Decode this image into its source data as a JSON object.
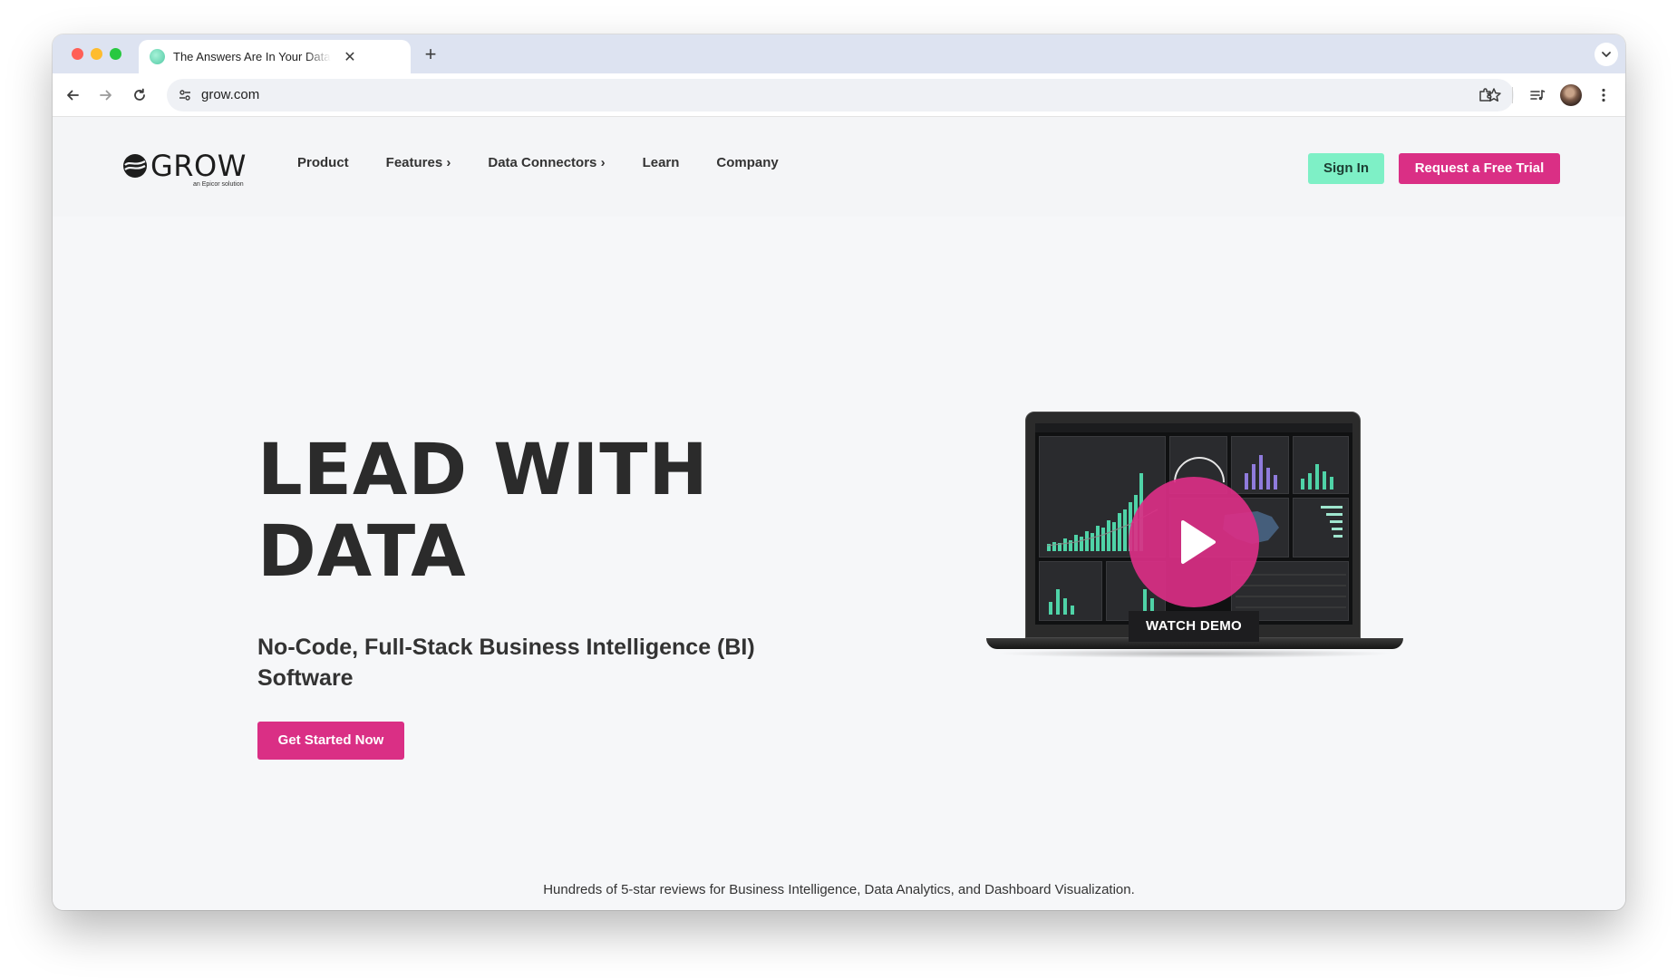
{
  "browser": {
    "tab_title": "The Answers Are In Your Data",
    "url": "grow.com"
  },
  "header": {
    "logo_text": "GROW",
    "logo_subtext": "an Epicor solution",
    "nav": [
      {
        "label": "Product"
      },
      {
        "label": "Features ›"
      },
      {
        "label": "Data Connectors ›"
      },
      {
        "label": "Learn"
      },
      {
        "label": "Company"
      }
    ],
    "signin_label": "Sign In",
    "trial_label": "Request a Free Trial"
  },
  "hero": {
    "title": "LEAD WITH DATA",
    "subtitle": "No-Code, Full-Stack Business Intelligence (BI) Software",
    "cta_label": "Get Started Now",
    "watch_demo_label": "WATCH DEMO"
  },
  "reviews_text": "Hundreds of 5-star reviews for Business Intelligence, Data Analytics, and Dashboard Visualization.",
  "colors": {
    "accent_pink": "#da2f85",
    "accent_mint": "#7ef0c6",
    "text_dark": "#2b2b2b"
  },
  "icons": [
    "close-icon",
    "plus-icon",
    "chevron-down-icon",
    "back-arrow-icon",
    "forward-arrow-icon",
    "reload-icon",
    "site-info-icon",
    "star-icon",
    "extensions-icon",
    "media-control-icon",
    "kebab-menu-icon",
    "play-icon"
  ]
}
